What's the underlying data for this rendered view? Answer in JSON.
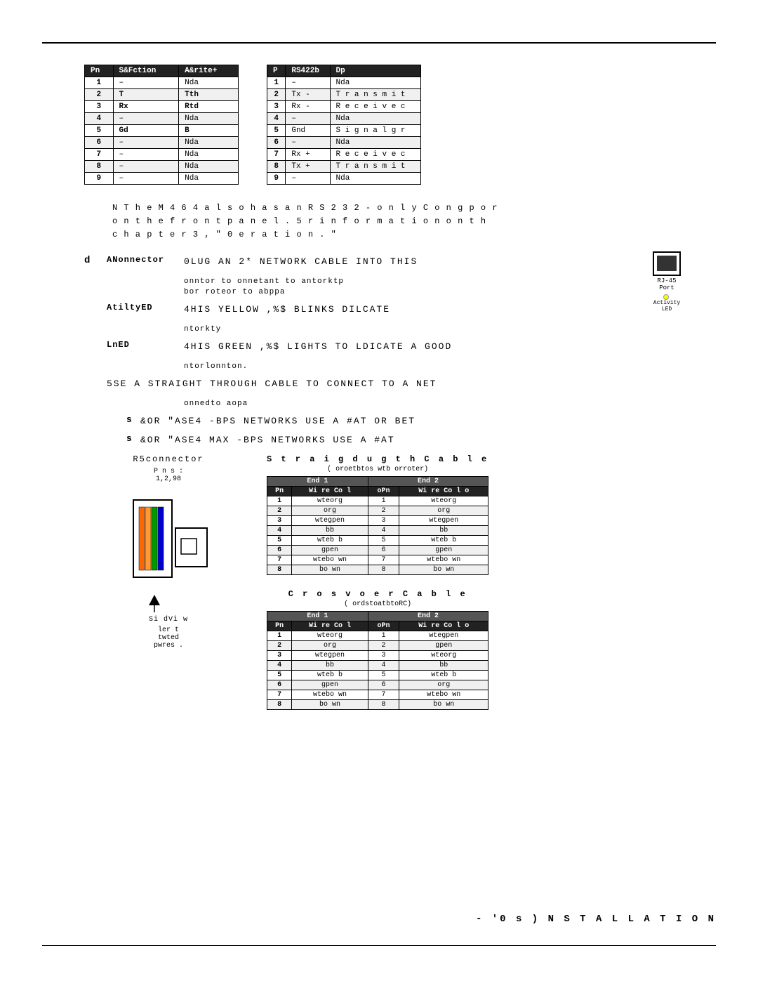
{
  "page": {
    "footer_text": "- '0   s ) N S T A L L A T I O N"
  },
  "table_left": {
    "title": "Pin",
    "col1": "S&Fction",
    "col2": "A&rite+",
    "rows": [
      {
        "pin": "1",
        "func": "–",
        "desc": "Nda"
      },
      {
        "pin": "2",
        "func": "T",
        "desc": "Tth"
      },
      {
        "pin": "3",
        "func": "Rx",
        "desc": "Rtd"
      },
      {
        "pin": "4",
        "func": "–",
        "desc": "Nda"
      },
      {
        "pin": "5",
        "func": "Gd",
        "desc": "B"
      },
      {
        "pin": "6",
        "func": "–",
        "desc": "Nda"
      },
      {
        "pin": "7",
        "func": "–",
        "desc": "Nda"
      },
      {
        "pin": "8",
        "func": "–",
        "desc": "Nda"
      },
      {
        "pin": "9",
        "func": "–",
        "desc": "Nda"
      }
    ]
  },
  "table_right": {
    "col0": "P",
    "col1": "RS422b",
    "col2": "Dp",
    "rows": [
      {
        "pin": "1",
        "func": "–",
        "desc": "Nda"
      },
      {
        "pin": "2",
        "func": "Tx-",
        "desc": "Transmit"
      },
      {
        "pin": "3",
        "func": "Rx-",
        "desc": "Receive c"
      },
      {
        "pin": "4",
        "func": "–",
        "desc": "Nda"
      },
      {
        "pin": "5",
        "func": "Gnd",
        "desc": "Signal gr"
      },
      {
        "pin": "6",
        "func": "–",
        "desc": "Nda"
      },
      {
        "pin": "7",
        "func": "Rx+",
        "desc": "Receive c"
      },
      {
        "pin": "8",
        "func": "Tx+",
        "desc": "Transmit"
      },
      {
        "pin": "9",
        "func": "–",
        "desc": "Nda"
      }
    ]
  },
  "note": {
    "line1": "N   T h e   M 4 6 4   a l s o   h a s   a n   R S 2 3 2 - o n l y   C o n g   p o r",
    "line2": "o n   t h e   f r o n t   p a n e l .   5 r   i n f o r m a t i o n   o n   t h",
    "line3": "c h a p t e r   3 ,   \" 0 e r a t i o n . \""
  },
  "steps": {
    "step_d": {
      "letter": "d",
      "label": "ANonnector",
      "text": "0LUG AN 2*   NETWORK CABLE INTO THIS",
      "sub1": "onntor to onnetant to antorktp",
      "sub2": "bor roteor to abppa"
    },
    "step_activity": {
      "label": "AtiltyED",
      "text": "4HIS YELLOW ,%$ BLINKS  DILCATE",
      "sub": "ntorkty"
    },
    "step_link": {
      "label": "LnED",
      "text": "4HIS GREEN ,%$ LIGHTS TO LDICATE A GOOD",
      "sub": "ntorlonnton."
    },
    "step_use": {
      "text": "5SE A STRAIGHT THROUGH CABLE TO CONNECT TO A NET",
      "sub": "onnedto aopa"
    },
    "bullet1": {
      "letter": "s",
      "text": "&OR \"ASE4  -BPS NETWORKS USE A #AT OR BET"
    },
    "bullet2": {
      "letter": "s",
      "text": "&OR \"ASE4 MAX  -BPS NETWORKS USE A #AT"
    }
  },
  "rj45": {
    "label": "RJ-45",
    "sublabel": "Port",
    "led_label": "Activity",
    "led2_label": "LED"
  },
  "straight_cable": {
    "title": "S t r a i g d u g t h C a b l e",
    "subtitle": "( oroetbtos      wtb      orroter)",
    "end1_header": "End 1",
    "end2_header": "End 2",
    "col_pin": "Pn",
    "col_wire": "Wi re Col",
    "rows": [
      {
        "pn1": "1",
        "wire1": "wteorg",
        "pn2": "1",
        "wire2": "wteorg"
      },
      {
        "pn1": "2",
        "wire1": "org",
        "pn2": "2",
        "wire2": "org"
      },
      {
        "pn1": "3",
        "wire1": "wtegpen",
        "pn2": "3",
        "wire2": "wtegpen"
      },
      {
        "pn1": "4",
        "wire1": "bb",
        "pn2": "4",
        "wire2": "bb"
      },
      {
        "pn1": "5",
        "wire1": "wteb b",
        "pn2": "5",
        "wire2": "wteb b"
      },
      {
        "pn1": "6",
        "wire1": "gpen",
        "pn2": "6",
        "wire2": "gpen"
      },
      {
        "pn1": "7",
        "wire1": "wtebo  wn",
        "pn2": "7",
        "wire2": "wtebo  wn"
      },
      {
        "pn1": "8",
        "wire1": "bo wn",
        "pn2": "8",
        "wire2": "bo wn"
      }
    ]
  },
  "crossover_cable": {
    "title": "C r o  s v o e r   C a b l e",
    "subtitle": "( ordstoatbtoRC)",
    "end1_header": "End 1",
    "end2_header": "End 2",
    "col_pin": "Pn",
    "col_wire": "Wi re Col",
    "rows": [
      {
        "pn1": "1",
        "wire1": "wteorg",
        "pn2": "1",
        "wire2": "wtegpen"
      },
      {
        "pn1": "2",
        "wire1": "org",
        "pn2": "2",
        "wire2": "gpen"
      },
      {
        "pn1": "3",
        "wire1": "wtegpen",
        "pn2": "3",
        "wire2": "wteorg"
      },
      {
        "pn1": "4",
        "wire1": "bb",
        "pn2": "4",
        "wire2": "bb"
      },
      {
        "pn1": "5",
        "wire1": "wteb b",
        "pn2": "5",
        "wire2": "wteb b"
      },
      {
        "pn1": "6",
        "wire1": "gpen",
        "pn2": "6",
        "wire2": "org"
      },
      {
        "pn1": "7",
        "wire1": "wtebo  wn",
        "pn2": "7",
        "wire2": "wtebo  wn"
      },
      {
        "pn1": "8",
        "wire1": "bo wn",
        "pn2": "8",
        "wire2": "bo wn"
      }
    ]
  },
  "connector_diagram": {
    "label": "R5connector",
    "pins_label": "Pns:",
    "pins_range": "1,2,98",
    "side_view": "Si dVi w",
    "arrow_label": "ler  t\ntwted\npwres   ."
  },
  "wire_colors": [
    "#ff6600",
    "#ff9933",
    "#006600",
    "#000099",
    "#0000ff",
    "#009900",
    "#996633",
    "#663300"
  ]
}
